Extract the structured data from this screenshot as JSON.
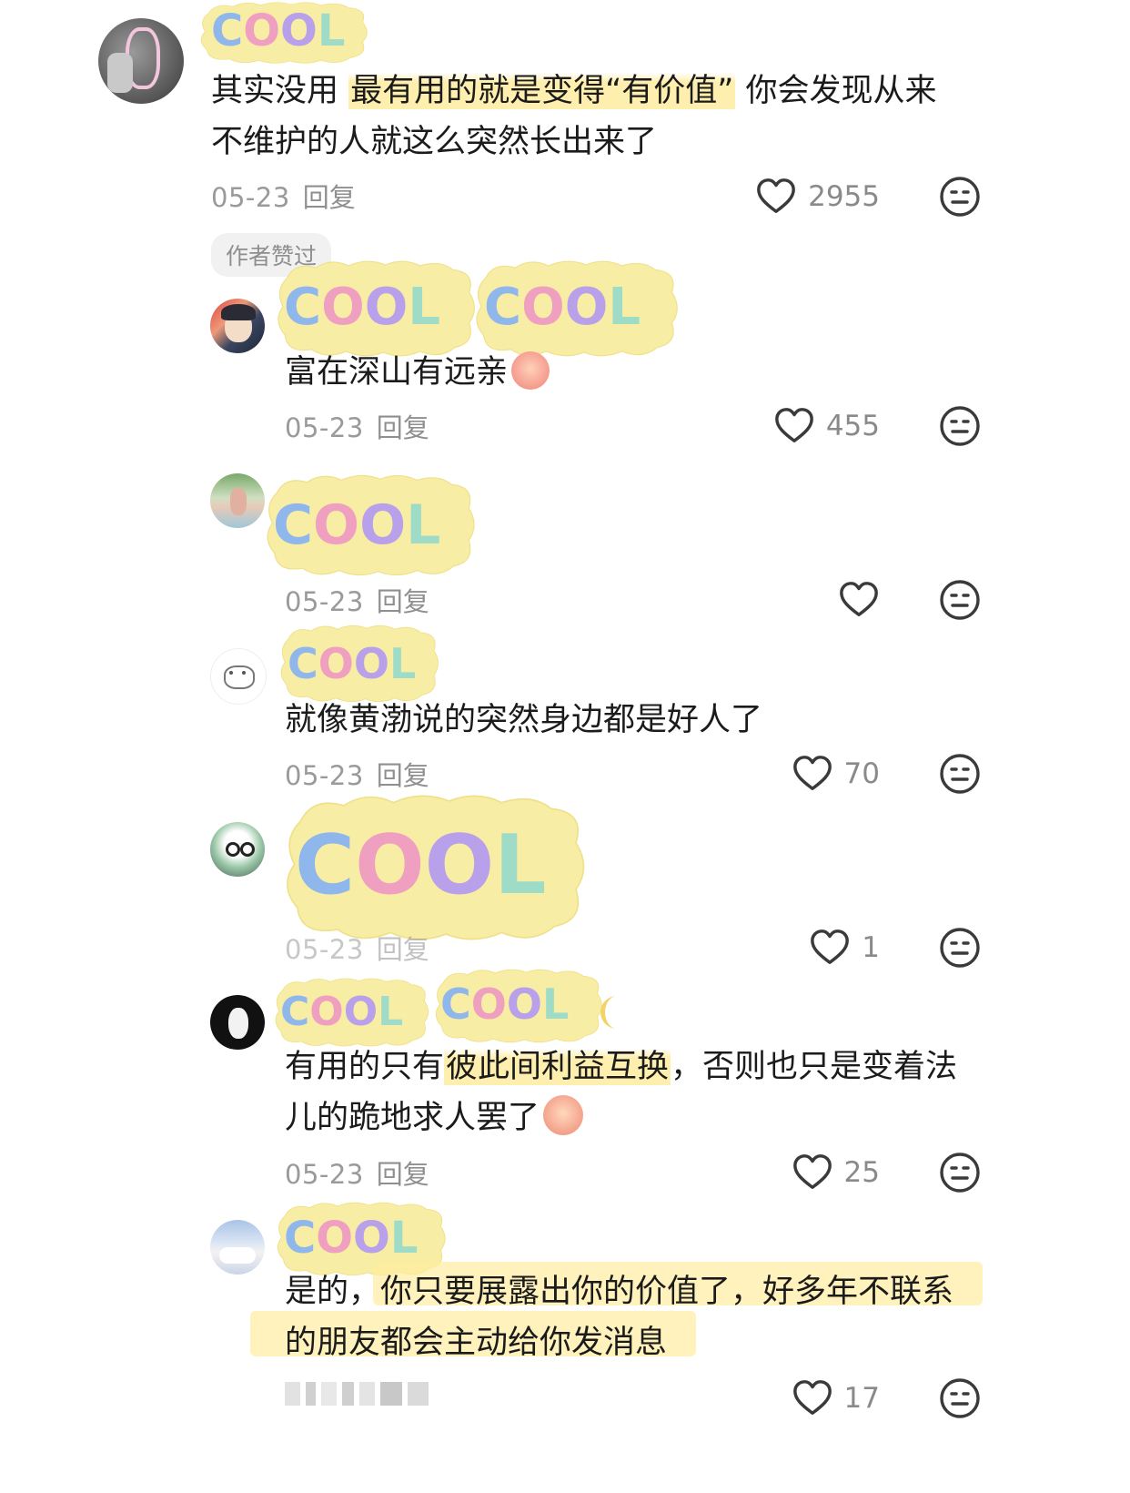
{
  "comments": [
    {
      "sticker": "COOL",
      "text_parts": [
        "其实没用 ",
        "最有用的就是变得“有价值”",
        " 你会发现从来"
      ],
      "text_line2": "不维护的人就这么突然长出来了",
      "date": "05-23",
      "reply": "回复",
      "likes": "2955",
      "badge": "作者赞过"
    },
    {
      "stickers": [
        "COOL",
        "COOL"
      ],
      "text": "富在深山有远亲",
      "date": "05-23",
      "reply": "回复",
      "likes": "455"
    },
    {
      "sticker": "COOL",
      "date": "05-23",
      "reply": "回复",
      "likes": ""
    },
    {
      "sticker": "COOL",
      "text": "就像黄渤说的突然身边都是好人了",
      "date": "05-23",
      "reply": "回复",
      "likes": "70"
    },
    {
      "sticker": "COOL",
      "date": "05-23",
      "reply": "回复",
      "likes": "1"
    },
    {
      "stickers": [
        "COOL",
        "COOL"
      ],
      "text_parts": [
        "有用的只有",
        "彼此间利益互换",
        "，否则也只是变着法"
      ],
      "text_line2": "儿的跪地求人罢了",
      "date": "05-23",
      "reply": "回复",
      "likes": "25"
    },
    {
      "sticker": "COOL",
      "text_line1": "是的，你只要展露出你的价值了，好多年不联系",
      "text_line2": "的朋友都会主动给你发消息",
      "likes": "17"
    }
  ],
  "icons": {
    "like": "heart-outline-icon",
    "dislike": "neutral-face-icon",
    "emoji": "crying-face-emoji",
    "moon": "crescent-moon-icon"
  },
  "colors": {
    "sticker_bg": "#f7eca0",
    "highlight": "#ffeca0",
    "meta_gray": "#9a9a9a"
  }
}
